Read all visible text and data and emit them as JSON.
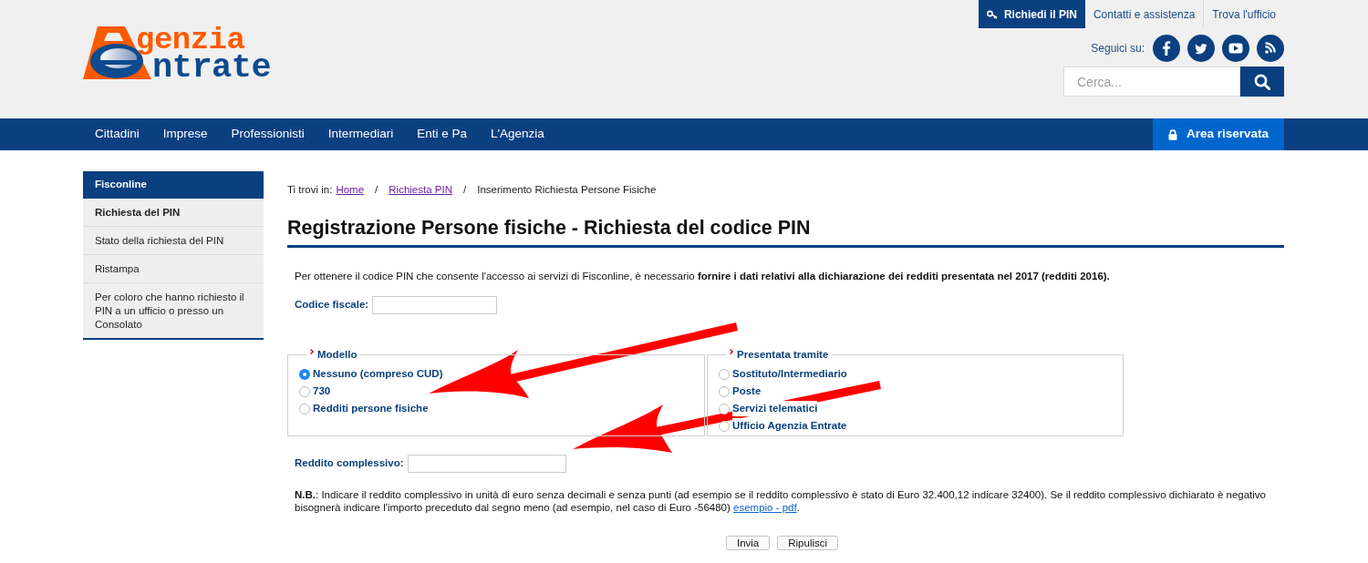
{
  "header": {
    "logo": {
      "line_1": "genzia",
      "line_2": "ntrate"
    },
    "top_links": [
      {
        "label": "Richiedi il PIN",
        "highlighted": true
      },
      {
        "label": "Contatti e assistenza",
        "highlighted": false
      },
      {
        "label": "Trova l'ufficio",
        "highlighted": false
      }
    ],
    "social_label": "Seguici su:",
    "search": {
      "placeholder": "Cerca..."
    }
  },
  "nav": {
    "items": [
      "Cittadini",
      "Imprese",
      "Professionisti",
      "Intermediari",
      "Enti e Pa",
      "L'Agenzia"
    ],
    "reserved_area": "Area riservata"
  },
  "sidebar": {
    "title": "Fisconline",
    "items": [
      {
        "label": "Richiesta del PIN",
        "selected": true
      },
      {
        "label": "Stato della richiesta del PIN",
        "selected": false
      },
      {
        "label": "Ristampa",
        "selected": false
      },
      {
        "label": "Per coloro che hanno richiesto il PIN a un ufficio o presso un Consolato",
        "selected": false
      }
    ]
  },
  "breadcrumb": {
    "prefix": "Ti trovi in:",
    "separator": "/",
    "items": [
      {
        "label": "Home",
        "kind": "link"
      },
      {
        "label": "Richiesta PIN",
        "kind": "link"
      },
      {
        "label": "Inserimento Richiesta Persone Fisiche",
        "kind": "current"
      }
    ]
  },
  "page_title": "Registrazione Persone fisiche - Richiesta del codice PIN",
  "intro": "Per ottenere il codice PIN che consente l'accesso ai servizi di Fisconline, è necessario **fornire i dati relativi alla dichiarazione dei redditi presentata nel 2017 (redditi 2016).**",
  "form": {
    "codice_fiscale": {
      "label": "Codice fiscale:"
    },
    "fieldsets": [
      {
        "legend": "Modello",
        "options": [
          {
            "label": "Nessuno (compreso CUD)",
            "selected": true
          },
          {
            "label": "730",
            "selected": false
          },
          {
            "label": "Redditi persone fisiche",
            "selected": false
          }
        ]
      },
      {
        "legend": "Presentata tramite",
        "options": [
          {
            "label": "Sostituto/Intermediario",
            "selected": false
          },
          {
            "label": "Poste",
            "selected": false
          },
          {
            "label": "Servizi telematici",
            "selected": false
          },
          {
            "label": "Ufficio Agenzia Entrate",
            "selected": false
          }
        ]
      }
    ],
    "reddito": {
      "label": "Reddito complessivo:"
    },
    "note": {
      "text": "**N.B.**: Indicare il reddito complessivo in unità di euro senza decimali e senza punti (ad esempio se il reddito complessivo è stato di Euro 32.400,12 indicare 32400). Se il reddito complessivo dichiarato è negativo bisognerà indicare l'importo preceduto dal segno meno (ad esempio, nel caso di Euro -56480) ",
      "link": "esempio - pdf",
      "after": "."
    },
    "buttons": [
      "Invia",
      "Ripulisci"
    ]
  }
}
